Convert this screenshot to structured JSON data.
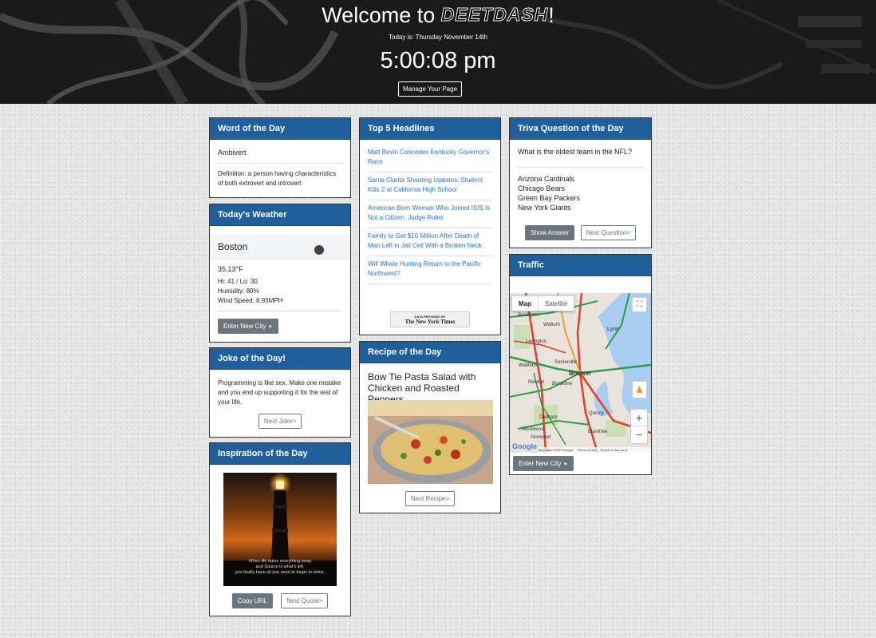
{
  "header": {
    "welcome_prefix": "Welcome to",
    "brand": "DEETDASH",
    "welcome_suffix": "!",
    "date_line": "Today is: Thursday November 14th",
    "clock": "5:00:08 pm",
    "manage_label": "Manage Your Page"
  },
  "word": {
    "title": "Word of the Day",
    "word": "Ambivert",
    "definition": "Definition: a person having characteristics of both extrovert and introvert"
  },
  "weather": {
    "title": "Today's Weather",
    "city": "Boston",
    "temp": "35.13°F",
    "hilo": "Hi: 41 / Lo: 30",
    "humidity": "Humidity: 80%",
    "wind": "Wind Speed: 6.93MPH",
    "city_button": "Enter New City"
  },
  "joke": {
    "title": "Joke of the Day!",
    "text": "Programming is like sex. Make one mistake and you end up supporting it for the rest of your life.",
    "next_label": "Next Joke>"
  },
  "inspiration": {
    "title": "Inspiration of the Day",
    "quote_line1": "When life takes everything away",
    "quote_line2": "and Source is what's left,",
    "quote_line3": "you finally have all you need to begin to shine.",
    "copy_label": "Copy URL",
    "next_label": "Next Quote>"
  },
  "headlines": {
    "title": "Top 5 Headlines",
    "items": [
      "Matt Bevin Concedes Kentucky Governor's Race",
      "Santa Clarita Shooting Updates: Student Kills 2 at California High School",
      "American-Born Woman Who Joined ISIS Is Not a Citizen, Judge Rules",
      "Family to Get $10 Million After Death of Man Left in Jail Cell With a Broken Neck",
      "Will Whale Hunting Return to the Pacific Northwest?"
    ],
    "credit_small": "DATA PROVIDED BY",
    "credit_big": "The New York Times"
  },
  "recipe": {
    "title": "Recipe of the Day",
    "name": "Bow Tie Pasta Salad with Chicken and Roasted Peppers",
    "next_label": "Next Recipe>"
  },
  "trivia": {
    "title": "Triva Question of the Day",
    "question": "What is the oldest team in the NFL?",
    "answers": [
      "Arizona Cardinals",
      "Chicago Bears",
      "Green Bay Packers",
      "New York Giants"
    ],
    "show_label": "Show Answer",
    "next_label": "Next Question>"
  },
  "traffic": {
    "title": "Traffic",
    "map_tab": "Map",
    "satellite_tab": "Satellite",
    "zoom_in": "+",
    "zoom_out": "−",
    "places": [
      "Burlington",
      "Woburn",
      "Lynn",
      "Lexington",
      "Somerville",
      "Waltham",
      "Boston",
      "Newton",
      "Brookline",
      "Quincy",
      "Dedham",
      "Westwood",
      "Braintree",
      "Norwood"
    ],
    "google": "Google",
    "map_data": "Map data ©2019 Google",
    "terms": "Terms of Use",
    "report": "Report a map error",
    "city_button": "Enter New City"
  },
  "colors": {
    "card_header": "#1f5f9b",
    "link": "#2a73c3",
    "button_gray": "#6c757d"
  }
}
